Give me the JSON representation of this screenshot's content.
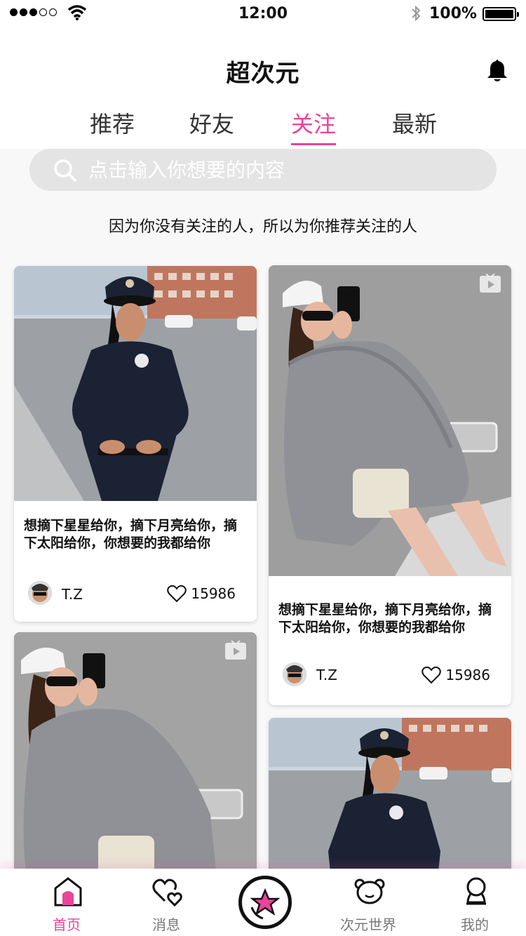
{
  "status_bar": {
    "time": "12:00",
    "battery": "100%"
  },
  "header": {
    "title": "超次元"
  },
  "tabs": [
    {
      "label": "推荐",
      "active": false
    },
    {
      "label": "好友",
      "active": false
    },
    {
      "label": "关注",
      "active": true
    },
    {
      "label": "最新",
      "active": false
    }
  ],
  "search": {
    "placeholder": "点击输入你想要的内容"
  },
  "notice": "因为你没有关注的人，所以为你推荐关注的人",
  "cards": [
    {
      "text": "想摘下星星给你，摘下月亮给你，摘下太阳给你，你想要的我都给你",
      "author": "T.Z",
      "likes": "15986",
      "image": "police-officer-photo"
    },
    {
      "text": "想摘下星星给你，摘下月亮给你，摘下太阳给你，你想要的我都给你",
      "author": "T.Z",
      "likes": "15986",
      "image": "sweater-girl-video"
    },
    {
      "image": "sweater-girl-video"
    },
    {
      "image": "police-officer-photo"
    }
  ],
  "tabbar": {
    "home": "首页",
    "messages": "消息",
    "world": "次元世界",
    "mine": "我的"
  },
  "colors": {
    "accent": "#e8449b",
    "search_bg": "#e4e4e4"
  }
}
